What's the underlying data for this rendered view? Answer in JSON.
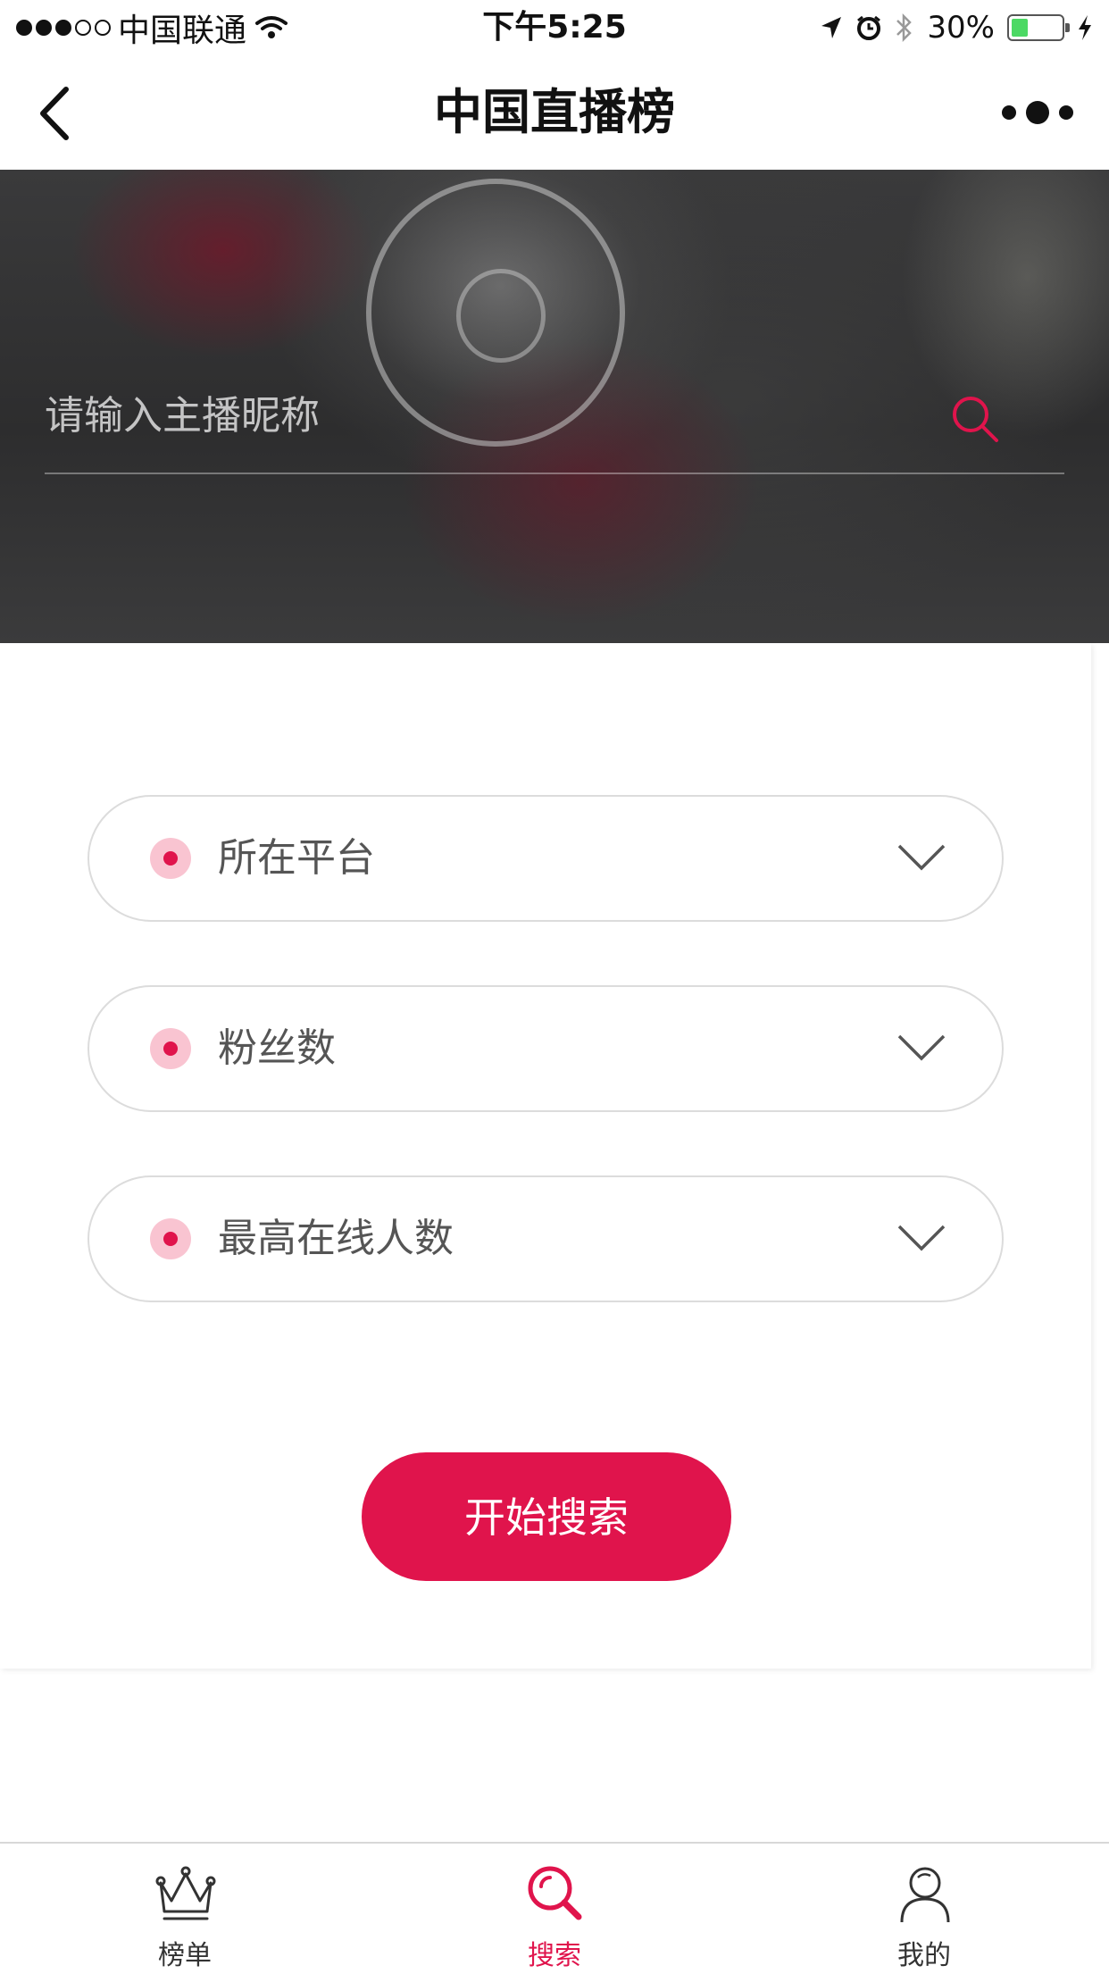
{
  "status_bar": {
    "carrier": "中国联通",
    "time": "下午5:25",
    "battery": "30%"
  },
  "nav": {
    "title": "中国直播榜",
    "back_icon": "chevron-left-icon",
    "more_icon": "more-dots-icon"
  },
  "search": {
    "placeholder": "请输入主播昵称",
    "value": "",
    "icon": "search-icon"
  },
  "filters": [
    {
      "label": "所在平台",
      "icon": "chevron-down-icon"
    },
    {
      "label": "粉丝数",
      "icon": "chevron-down-icon"
    },
    {
      "label": "最高在线人数",
      "icon": "chevron-down-icon"
    }
  ],
  "actions": {
    "search_button": "开始搜索"
  },
  "tabbar": {
    "items": [
      {
        "label": "榜单",
        "icon": "crown-icon",
        "active": false
      },
      {
        "label": "搜索",
        "icon": "search-icon",
        "active": true
      },
      {
        "label": "我的",
        "icon": "user-icon",
        "active": false
      }
    ]
  },
  "colors": {
    "accent": "#e0144c",
    "battery": "#4cd964"
  }
}
